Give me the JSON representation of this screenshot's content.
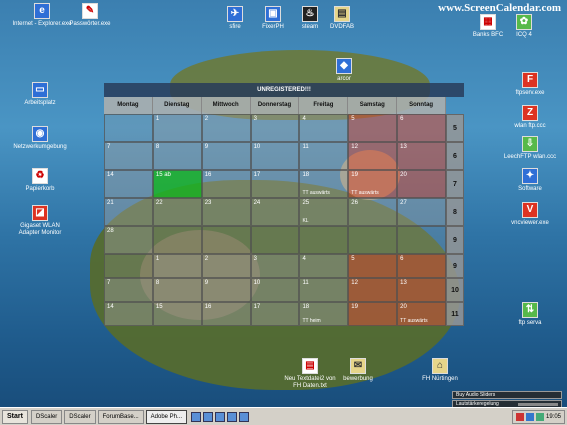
{
  "brand": "www.ScreenCalendar.com",
  "desktop_icons": [
    {
      "id": "internet",
      "label": "Internet - Explorer.exe",
      "glyph": "e"
    },
    {
      "id": "passwort",
      "label": "Passwörter.exe",
      "glyph": "✎"
    },
    {
      "id": "sfire",
      "label": "sfire",
      "glyph": "✈"
    },
    {
      "id": "fixer",
      "label": "FixerPH",
      "glyph": "▣"
    },
    {
      "id": "steam",
      "label": "steam",
      "glyph": "♨"
    },
    {
      "id": "dvd",
      "label": "DVDFAB",
      "glyph": "▤"
    },
    {
      "id": "banks",
      "label": "Banks BFC",
      "glyph": "▦"
    },
    {
      "id": "icq",
      "label": "ICQ 4",
      "glyph": "✿"
    },
    {
      "id": "arcor",
      "label": "arcor",
      "glyph": "◆"
    },
    {
      "id": "arbeitsplatz",
      "label": "Arbeitsplatz",
      "glyph": "▭"
    },
    {
      "id": "netzwerk",
      "label": "Netzwerkumgebung",
      "glyph": "◉"
    },
    {
      "id": "papierkorb",
      "label": "Papierkorb",
      "glyph": "♻"
    },
    {
      "id": "gigaset",
      "label": "Gigaset WLAN Adapter Monitor",
      "glyph": "◪"
    },
    {
      "id": "ftpsrv",
      "label": "ftpserv.exe",
      "glyph": "F"
    },
    {
      "id": "wlan",
      "label": "wlan ftp.ccc",
      "glyph": "Z"
    },
    {
      "id": "leech",
      "label": "LeechFTP wlan.ccc",
      "glyph": "⇩"
    },
    {
      "id": "software",
      "label": "Software",
      "glyph": "✦"
    },
    {
      "id": "vnc",
      "label": "vncviewer.exe",
      "glyph": "V"
    },
    {
      "id": "ftpserva",
      "label": "ftp serva",
      "glyph": "⇅"
    },
    {
      "id": "textdatei",
      "label": "Neu Textdatei2 von FH Daten.txt",
      "glyph": "▤"
    },
    {
      "id": "bewerbung",
      "label": "bewerbung",
      "glyph": "✉"
    },
    {
      "id": "fh",
      "label": "FH Nürtingen",
      "glyph": "⌂"
    }
  ],
  "calendar": {
    "title": "UNREGISTERED!!!",
    "weekdays": [
      "Montag",
      "Dienstag",
      "Mittwoch",
      "Donnerstag",
      "Freitag",
      "Samstag",
      "Sonntag"
    ],
    "weeks": [
      {
        "no": "5",
        "days": [
          "",
          "1",
          "2",
          "3",
          "4",
          "5",
          "6"
        ]
      },
      {
        "no": "6",
        "days": [
          "7",
          "8",
          "9",
          "10",
          "11",
          "12",
          "13"
        ]
      },
      {
        "no": "7",
        "days": [
          "14",
          "15 ab",
          "16",
          "17",
          "18",
          "19",
          "20"
        ]
      },
      {
        "no": "8",
        "days": [
          "21",
          "22",
          "23",
          "24",
          "25",
          "26",
          "27"
        ]
      },
      {
        "no": "9",
        "days": [
          "28",
          "",
          "",
          "",
          "",
          "",
          ""
        ]
      },
      {
        "no": "9",
        "days": [
          "",
          "1",
          "2",
          "3",
          "4",
          "5",
          "6"
        ]
      },
      {
        "no": "10",
        "days": [
          "7",
          "8",
          "9",
          "10",
          "11",
          "12",
          "13"
        ]
      },
      {
        "no": "11",
        "days": [
          "14",
          "15",
          "16",
          "17",
          "18",
          "19",
          "20"
        ]
      }
    ],
    "notes": {
      "w3_fri": "TT auswärts",
      "w3_sat": "TT auswärts",
      "w4_fri": "KL",
      "w8_fri": "TT heim",
      "w8_sun": "TT auswärts"
    }
  },
  "taskbar": {
    "start": "Start",
    "tasks": [
      "DScaler",
      "DScaler",
      "ForumBase...",
      "Adobe Ph...",
      "",
      ""
    ],
    "clock": "19:05"
  },
  "sliders": [
    {
      "label": "Buy Audio Sliders"
    },
    {
      "label": "Lautstärkeregelung"
    }
  ]
}
